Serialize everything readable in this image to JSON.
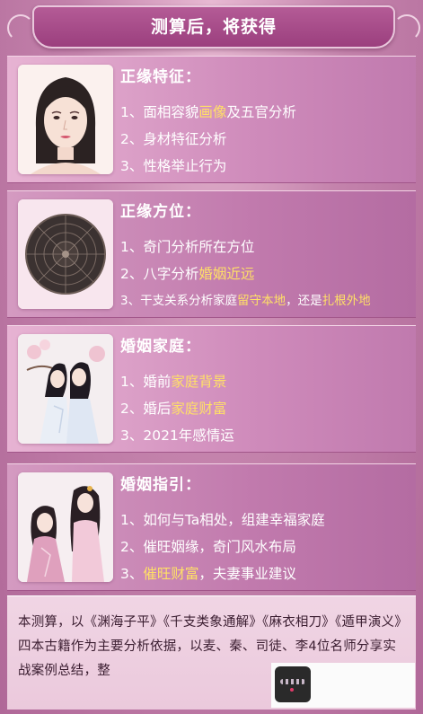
{
  "header": {
    "title": "测算后，将获得"
  },
  "panels": [
    {
      "title": "正缘特征：",
      "image": "portrait-face",
      "lines": [
        {
          "pre": "1、面相容貌",
          "hl": "画像",
          "post": "及五官分析"
        },
        {
          "pre": "2、身材特征分析",
          "hl": "",
          "post": ""
        },
        {
          "pre": "3、性格举止行为",
          "hl": "",
          "post": ""
        }
      ]
    },
    {
      "title": "正缘方位：",
      "image": "luopan-compass",
      "lines": [
        {
          "pre": "1、奇门分析所在方位",
          "hl": "",
          "post": ""
        },
        {
          "pre": "2、八字分析",
          "hl": "婚姻近远",
          "post": ""
        },
        {
          "pre": "3、干支关系分析家庭",
          "hl": "留守本地",
          "post": "，还是",
          "hl2": "扎根外地"
        }
      ]
    },
    {
      "title": "婚姻家庭：",
      "image": "couple-illustration",
      "lines": [
        {
          "pre": "1、婚前",
          "hl": "家庭背景",
          "post": ""
        },
        {
          "pre": "2、婚后",
          "hl": "家庭财富",
          "post": ""
        },
        {
          "pre": "3、2021年感情运",
          "hl": "",
          "post": ""
        }
      ]
    },
    {
      "title": "婚姻指引：",
      "image": "women-illustration",
      "lines": [
        {
          "pre": "1、如何与Ta相处，组建幸福家庭",
          "hl": "",
          "post": ""
        },
        {
          "pre": "2、催旺姻缘，奇门风水布局",
          "hl": "",
          "post": ""
        },
        {
          "pre": "3、",
          "hl": "催旺财富",
          "post": "，夫妻事业建议"
        }
      ]
    }
  ],
  "footer": {
    "text": "本测算，以《渊海子平》《千支类象通解》《麻衣相刀》《遁甲演义》四本古籍作为主要分析依据，以麦、秦、司徒、李4位名师分享实战案例总结，整"
  },
  "colors": {
    "highlight": "#ffe066",
    "header": "#9b3f7e",
    "panel": "#cf8bbb"
  }
}
